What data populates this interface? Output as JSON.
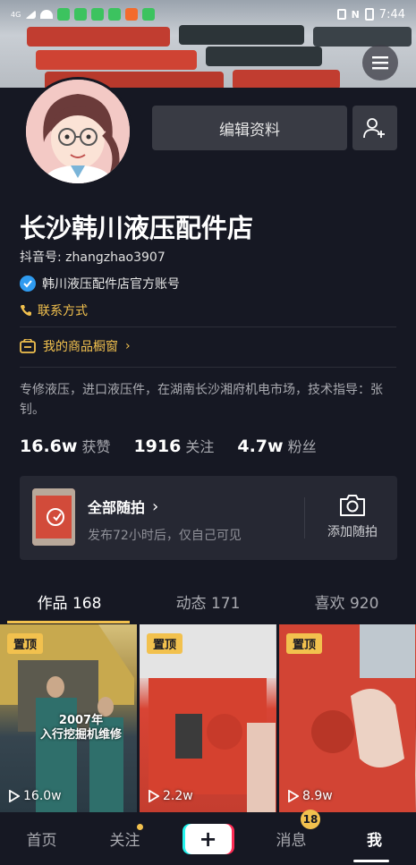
{
  "status_bar": {
    "time": "7:44",
    "signal_text": "4G",
    "icons": [
      "signal-icon",
      "wifi-icon",
      "app-icon",
      "app-icon",
      "app-icon",
      "app-icon",
      "app-icon",
      "app-icon"
    ],
    "right_icons": [
      "vibrate-icon",
      "nfc-icon",
      "battery-icon"
    ]
  },
  "header": {
    "menu_icon": "menu-icon"
  },
  "profile": {
    "edit_label": "编辑资料",
    "add_friend_icon": "add-friend-icon",
    "name": "长沙韩川液压配件店",
    "douyin_id": "抖音号: zhangzhao3907",
    "verified_text": "韩川液压配件店官方账号",
    "contact_text": "联系方式",
    "shop_text": "我的商品橱窗",
    "bio": "专修液压，进口液压件，在湖南长沙湘府机电市场，技术指导：张钊。"
  },
  "stats": [
    {
      "value": "16.6w",
      "label": "获赞"
    },
    {
      "value": "1916",
      "label": "关注"
    },
    {
      "value": "4.7w",
      "label": "粉丝"
    }
  ],
  "snap": {
    "title": "全部随拍",
    "subtitle": "发布72小时后，仅自己可见",
    "add_label": "添加随拍"
  },
  "tabs": [
    {
      "label": "作品 168"
    },
    {
      "label": "动态 171"
    },
    {
      "label": "喜欢 920"
    }
  ],
  "videos": [
    {
      "pin": "置顶",
      "plays": "16.0w",
      "caption": "2007年\n入行挖掘机维修"
    },
    {
      "pin": "置顶",
      "plays": "2.2w"
    },
    {
      "pin": "置顶",
      "plays": "8.9w"
    }
  ],
  "bottom_nav": {
    "home": "首页",
    "follow": "关注",
    "plus": "+",
    "messages": "消息",
    "messages_badge": "18",
    "me": "我"
  }
}
